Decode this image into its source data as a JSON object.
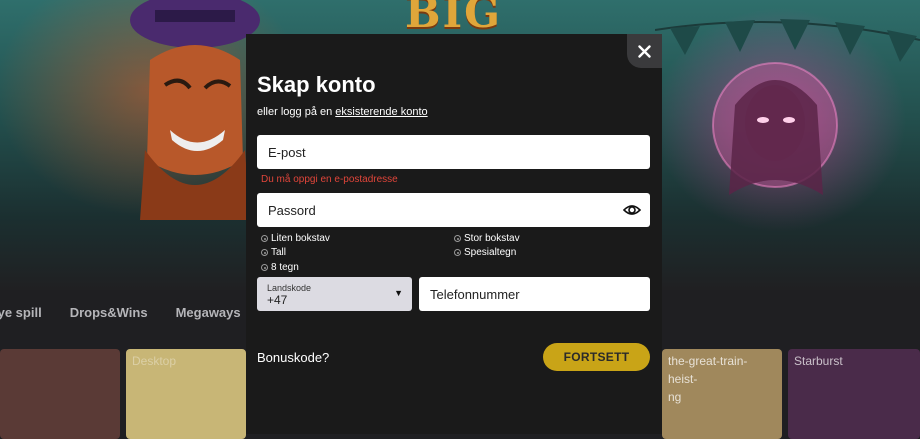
{
  "background": {
    "banner_text": "BIG",
    "categories": [
      "lye spill",
      "Drops&Wins",
      "Megaways"
    ],
    "tiles": [
      {
        "label": ""
      },
      {
        "label": "Desktop"
      },
      {
        "label": "the-great-train-heist-\nng"
      },
      {
        "label": "Starburst"
      }
    ]
  },
  "modal": {
    "title": "Skap konto",
    "login_prefix": "eller logg på en ",
    "login_link": "eksisterende konto",
    "email_placeholder": "E-post",
    "email_error": "Du må oppgi en e-postadresse",
    "password_placeholder": "Passord",
    "password_requirements": [
      "Liten bokstav",
      "Stor bokstav",
      "Tall",
      "Spesialtegn",
      "8 tegn"
    ],
    "country_code_label": "Landskode",
    "country_code_value": "+47",
    "phone_placeholder": "Telefonnummer",
    "bonus_code": "Bonuskode?",
    "continue_button": "FORTSETT"
  },
  "icons": {
    "close": "close-icon",
    "password_toggle": "eye-icon",
    "requirement": "requirement-dot-icon",
    "dropdown": "chevron-down-icon"
  },
  "colors": {
    "accent": "#c9a417",
    "error": "#e0453a",
    "modal_bg": "#1a1a1a"
  }
}
